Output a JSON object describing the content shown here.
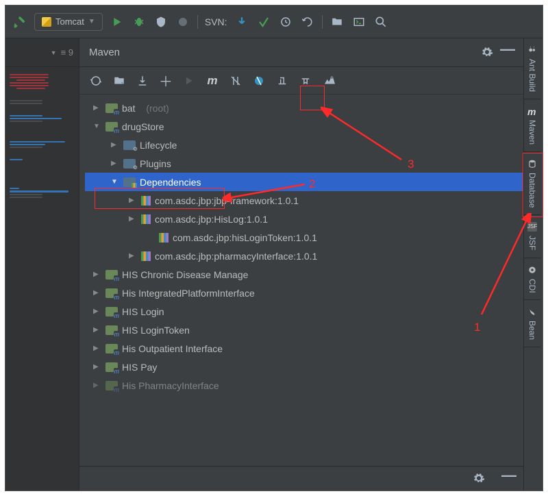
{
  "toolbar": {
    "run_config": "Tomcat",
    "svn_label": "SVN:"
  },
  "gutter": {
    "indicator": "≡ 9"
  },
  "right_tabs": {
    "ant": "Ant Build",
    "maven": "Maven",
    "database": "Database",
    "jsf": "JSF",
    "cdi": "CDI",
    "bean": "Bean"
  },
  "tool": {
    "title": "Maven"
  },
  "tree": {
    "root1": {
      "label": "bat",
      "suffix": "(root)"
    },
    "drugstore": {
      "label": "drugStore"
    },
    "lifecycle": "Lifecycle",
    "plugins": "Plugins",
    "dependencies": "Dependencies",
    "deps": {
      "d1": "com.asdc.jbp:jbp-framework:1.0.1",
      "d2": "com.asdc.jbp:HisLog:1.0.1",
      "d3": "com.asdc.jbp:hisLoginToken:1.0.1",
      "d4": "com.asdc.jbp:pharmacyInterface:1.0.1"
    },
    "mods": {
      "m1": "HIS Chronic Disease Manage",
      "m2": "His IntegratedPlatformInterface",
      "m3": "HIS Login",
      "m4": "HIS LoginToken",
      "m5": "His Outpatient Interface",
      "m6": "HIS Pay",
      "m7": "His PharmacyInterface"
    }
  },
  "anno": {
    "n1": "1",
    "n2": "2",
    "n3": "3"
  }
}
